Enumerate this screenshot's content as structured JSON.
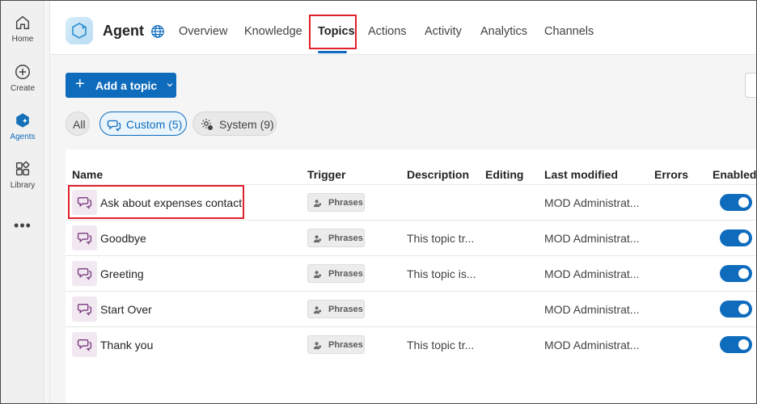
{
  "rail": {
    "items": [
      {
        "label": "Home",
        "icon": "home-icon"
      },
      {
        "label": "Create",
        "icon": "plus-circle-icon"
      },
      {
        "label": "Agents",
        "icon": "agents-icon"
      },
      {
        "label": "Library",
        "icon": "library-icon"
      }
    ],
    "more": "•••"
  },
  "header": {
    "agent_name": "Agent",
    "tabs": [
      {
        "label": "Overview"
      },
      {
        "label": "Knowledge"
      },
      {
        "label": "Topics"
      },
      {
        "label": "Actions"
      },
      {
        "label": "Activity"
      },
      {
        "label": "Analytics"
      },
      {
        "label": "Channels"
      }
    ],
    "active_tab": "Topics"
  },
  "toolbar": {
    "add_topic_label": "Add a topic"
  },
  "filters": [
    {
      "label": "All"
    },
    {
      "label": "Custom (5)"
    },
    {
      "label": "System (9)"
    }
  ],
  "table": {
    "columns": [
      "Name",
      "Trigger",
      "Description",
      "Editing",
      "Last modified",
      "Errors",
      "Enabled"
    ],
    "rows": [
      {
        "name": "Ask about expenses contact",
        "trigger": "Phrases",
        "description": "",
        "last_modified": "MOD Administrat...",
        "enabled": true
      },
      {
        "name": "Goodbye",
        "trigger": "Phrases",
        "description": "This topic tr...",
        "last_modified": "MOD Administrat...",
        "enabled": true
      },
      {
        "name": "Greeting",
        "trigger": "Phrases",
        "description": "This topic is...",
        "last_modified": "MOD Administrat...",
        "enabled": true
      },
      {
        "name": "Start Over",
        "trigger": "Phrases",
        "description": "",
        "last_modified": "MOD Administrat...",
        "enabled": true
      },
      {
        "name": "Thank you",
        "trigger": "Phrases",
        "description": "This topic tr...",
        "last_modified": "MOD Administrat...",
        "enabled": true
      }
    ]
  },
  "colors": {
    "accent": "#0f6cbd",
    "highlight": "#e0202a",
    "topic_icon_bg": "#f1e8f2",
    "topic_icon": "#7a3b7e"
  }
}
